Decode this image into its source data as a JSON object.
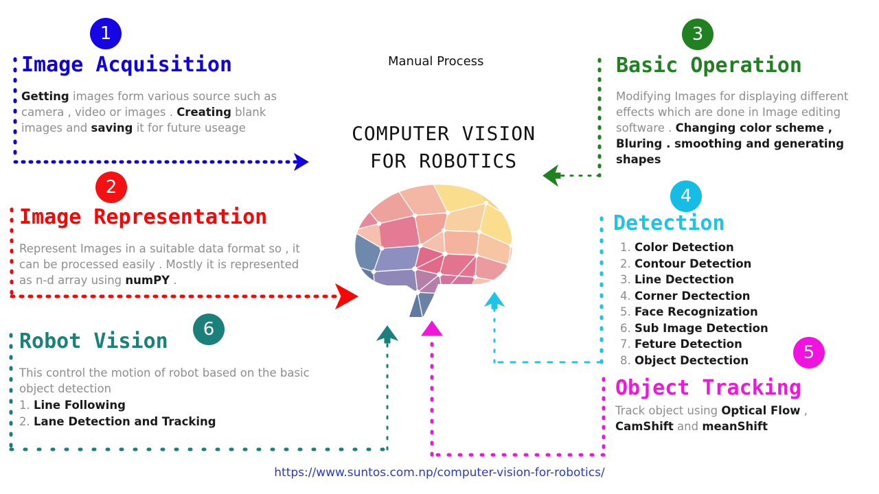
{
  "center": {
    "manual_process_label": "Manual Process",
    "title_line1": "COMPUTER VISION",
    "title_line2": "FOR ROBOTICS",
    "brain_icon": "low-poly-brain-icon"
  },
  "footer": {
    "url": "https://www.suntos.com.np/computer-vision-for-robotics/",
    "url_color": "#2a39c8"
  },
  "sections": [
    {
      "number": "1",
      "heading": "Image Acquisition",
      "color": "#0f00e0",
      "badge_color": "#1606e3",
      "body_html": "<b>Getting</b> images form various source such as camera , video or images . <b>Creating</b> blank images and <b>saving</b> it for future useage",
      "body_plain": "Getting images form various source such as camera , video or images . Creating blank images and saving it for future useage",
      "items": []
    },
    {
      "number": "2",
      "heading": "Image Representation",
      "color": "#fa0505",
      "badge_color": "#f51111",
      "body_html": "Represent Images in a suitable data format so , it can be processed easily  . Mostly it is represented as n-d array using <b>numPY</b> .",
      "body_plain": "Represent Images in a suitable data format so , it can be processed easily . Mostly it is represented as n-d array using numPY .",
      "items": []
    },
    {
      "number": "3",
      "heading": "Basic Operation",
      "color": "#218021",
      "badge_color": "#218021",
      "body_html": "Modifying Images for displaying different effects which are done in Image editing software . <b>Changing color scheme , Bluring . smoothing and generating shapes</b>",
      "body_plain": "Modifying Images for displaying different effects which are done in Image editing software . Changing color scheme , Bluring . smoothing and generating shapes",
      "items": []
    },
    {
      "number": "4",
      "heading": "Detection",
      "color": "#1ec3e8",
      "badge_color": "#15bde4",
      "body_html": "",
      "body_plain": "",
      "items": [
        "Color Detection",
        "Contour Detection",
        "Line Dectection",
        "Corner Dectection",
        "Face Recognization",
        "Sub Image Detection",
        "Feture Detection",
        "Object Dectection"
      ]
    },
    {
      "number": "5",
      "heading": "Object Tracking",
      "color": "#ef18d8",
      "badge_color": "#f012de",
      "body_html": "Track object using <b>Optical Flow</b> , <b>CamShift</b> and <b>meanShift</b>",
      "body_plain": "Track object using Optical Flow , CamShift and meanShift",
      "items": []
    },
    {
      "number": "6",
      "heading": "Robot Vision",
      "color": "#1b7f7c",
      "badge_color": "#1b7f7c",
      "body_html": "This control the motion of robot based on the basic object detection",
      "body_plain": "This control the motion of robot based on the basic object detection",
      "items": [
        "Line Following",
        "Lane Detection and Tracking"
      ]
    }
  ],
  "list_numbers": [
    "1.",
    "2.",
    "3.",
    "4.",
    "5.",
    "6.",
    "7.",
    "8."
  ]
}
